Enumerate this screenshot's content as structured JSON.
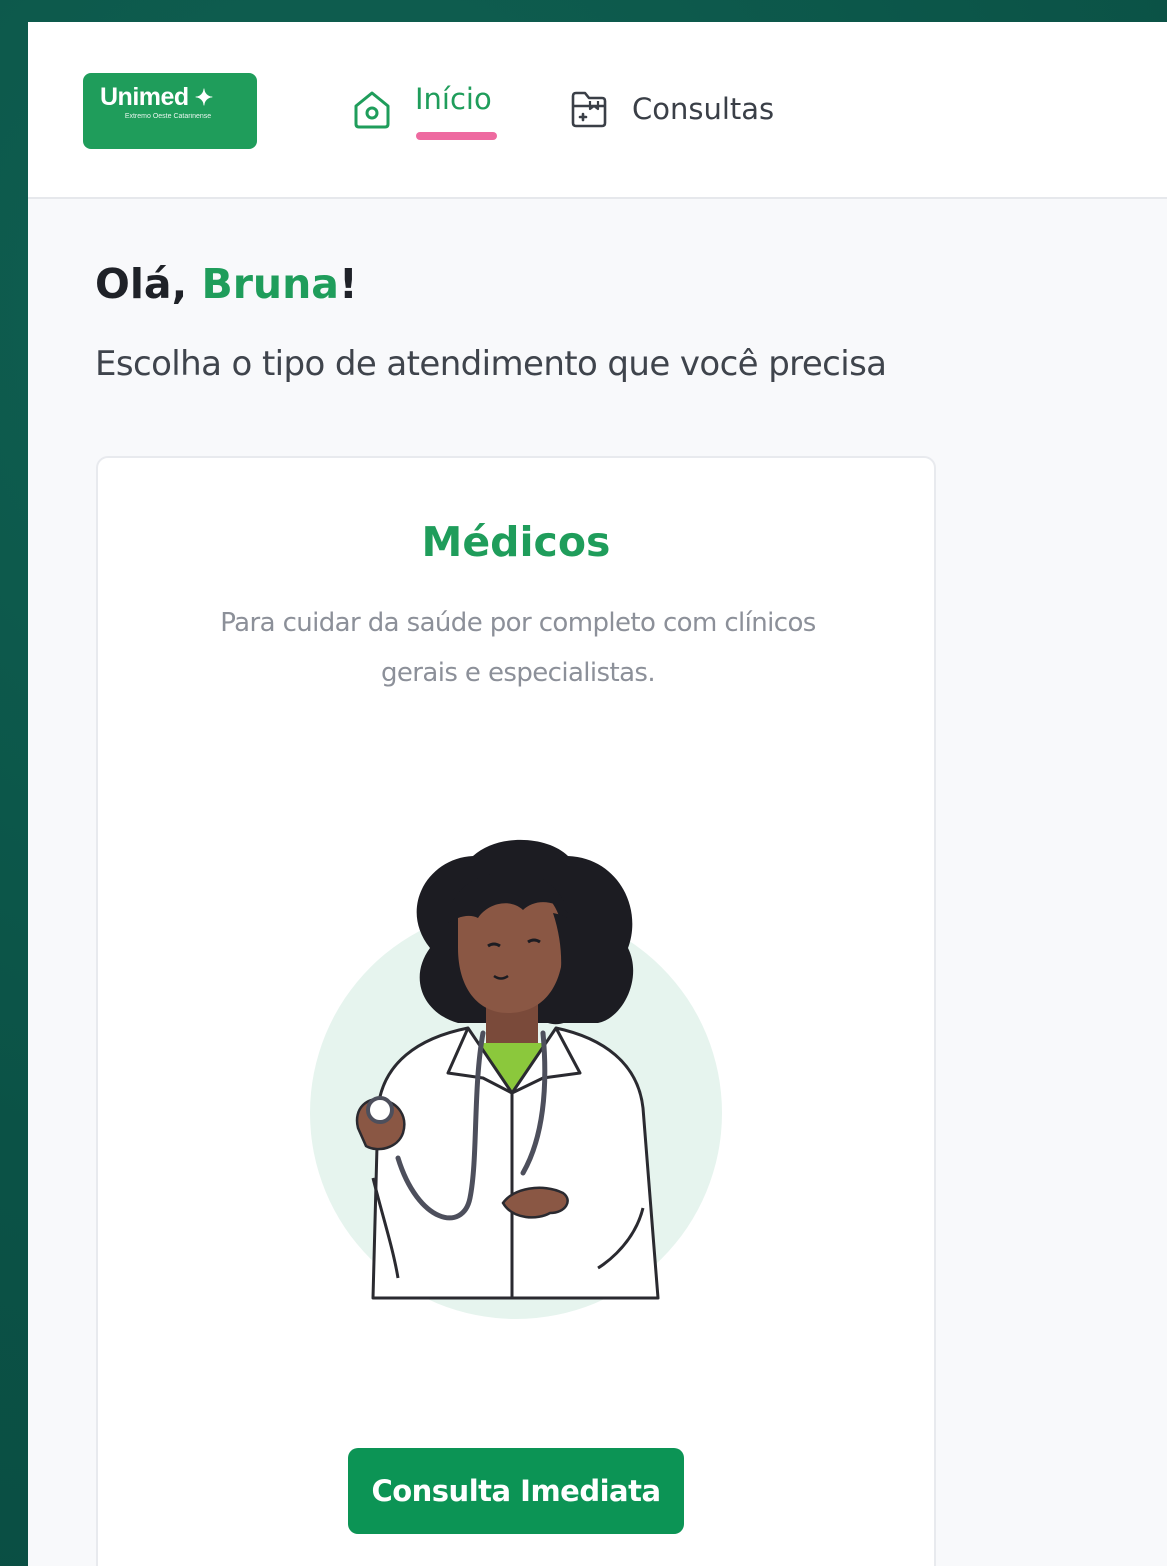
{
  "header": {
    "logo": {
      "name": "Unimed",
      "mark": "✦",
      "subtitle": "Extremo Oeste Catarinense"
    },
    "nav": [
      {
        "label": "Início",
        "icon": "home-icon",
        "active": true
      },
      {
        "label": "Consultas",
        "icon": "medical-folder-icon",
        "active": false
      }
    ]
  },
  "greeting": {
    "prefix": "Olá, ",
    "name": "Bruna",
    "suffix": "!"
  },
  "subtitle": "Escolha o tipo de atendimento que você precisa",
  "card": {
    "title": "Médicos",
    "description": "Para cuidar da saúde por completo com clínicos gerais e especialistas.",
    "illustration": "doctor-with-stethoscope",
    "button_label": "Consulta Imediata"
  },
  "colors": {
    "brand_green": "#1f9d5b",
    "button_green": "#0c9455",
    "active_underline": "#ee6aa0",
    "outer_background": "#0d5a4e",
    "page_background": "#f8f9fb"
  }
}
